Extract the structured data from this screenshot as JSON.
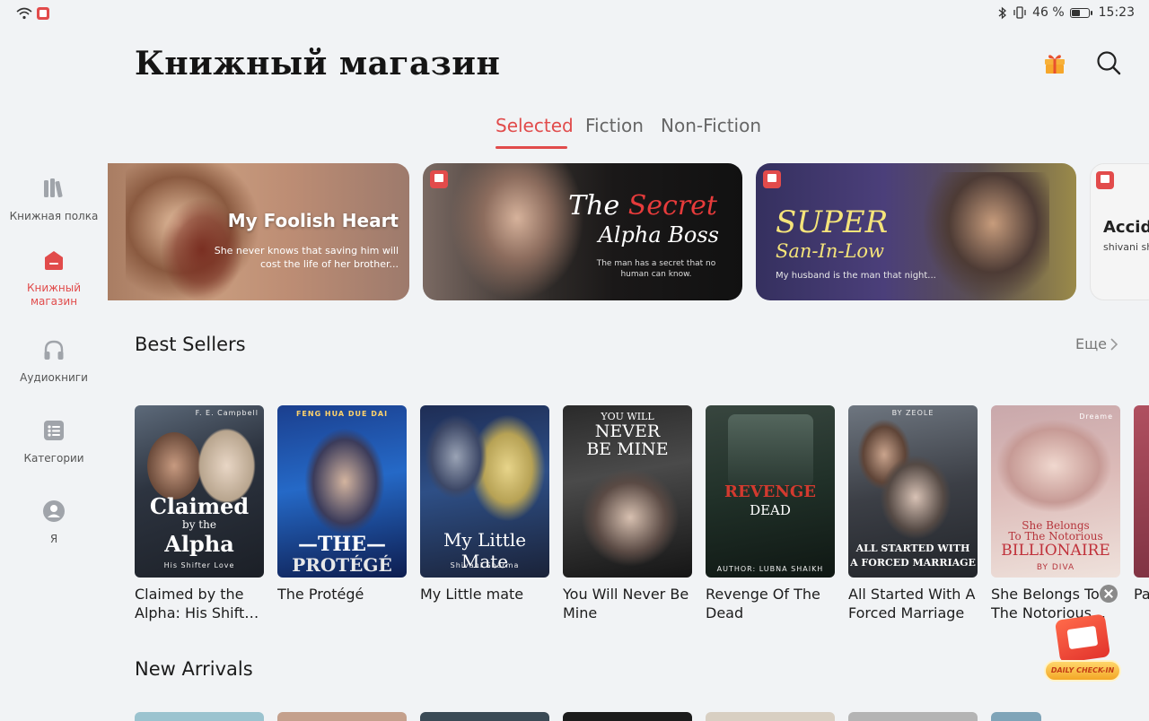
{
  "status": {
    "battery_text": "46 %",
    "time": "15:23"
  },
  "header": {
    "title": "Книжный магазин"
  },
  "tabs": [
    {
      "label": "Selected",
      "active": true
    },
    {
      "label": "Fiction",
      "active": false
    },
    {
      "label": "Non-Fiction",
      "active": false
    }
  ],
  "sidebar": {
    "items": [
      {
        "label": "Книжная полка",
        "icon": "bookshelf-icon"
      },
      {
        "label": "Книжный магазин",
        "icon": "store-icon",
        "active": true
      },
      {
        "label": "Аудиокниги",
        "icon": "headphones-icon"
      },
      {
        "label": "Категории",
        "icon": "categories-icon"
      },
      {
        "label": "Я",
        "icon": "profile-icon"
      }
    ]
  },
  "banners": [
    {
      "title": "My Foolish Heart",
      "subtitle": "She never knows that saving him will cost the life of her brother..."
    },
    {
      "title_part1": "The ",
      "title_part2": "Secret",
      "title_line2": "Alpha Boss",
      "subtitle": "The man has a secret that no human can know."
    },
    {
      "title_line1": "SUPER",
      "title_line2": "San-In-Low",
      "subtitle": "My husband is the man that night..."
    },
    {
      "title": "Accider",
      "subtitle": "shivani sha"
    }
  ],
  "best_sellers": {
    "title": "Best Sellers",
    "more": "Еще",
    "books": [
      {
        "title": "Claimed by the Alpha: His Shifter Love",
        "cover_author": "F. E. Campbell",
        "cover_l1": "Claimed",
        "cover_l2": "by the",
        "cover_l3": "Alpha",
        "cover_sub": "His Shifter Love"
      },
      {
        "title": "The Protégé",
        "cover_author": "FENG HUA DUE DAI",
        "cover_l1": "—THE—",
        "cover_l2": "PROTÉGÉ"
      },
      {
        "title": "My Little mate",
        "cover_l1": "My Little Mate",
        "cover_sub": "Shivani Sharma"
      },
      {
        "title": "You Will Never Be Mine",
        "cover_l1": "YOU WILL",
        "cover_l2": "NEVER",
        "cover_l3": "BE MINE"
      },
      {
        "title": "Revenge Of The Dead",
        "cover_l1": "REVENGE",
        "cover_l2": "DEAD",
        "cover_author": "AUTHOR: LUBNA SHAIKH"
      },
      {
        "title": "All Started With A Forced Marriage",
        "cover_author": "BY ZEOLE",
        "cover_l1": "ALL STARTED WITH",
        "cover_l2": "A FORCED MARRIAGE"
      },
      {
        "title": "She Belongs To The Notorious Billionaire",
        "cover_badge": "Dreame",
        "cover_l1": "She Belongs",
        "cover_l2": "To The Notorious",
        "cover_l3": "BILLIONAIRE",
        "cover_author": "BY DIVA"
      },
      {
        "title": "Pa De"
      }
    ]
  },
  "new_arrivals": {
    "title": "New Arrivals"
  },
  "checkin": {
    "label": "DAILY CHECK-IN"
  },
  "colors": {
    "accent": "#e14b4b",
    "background": "#f1f3f5"
  }
}
